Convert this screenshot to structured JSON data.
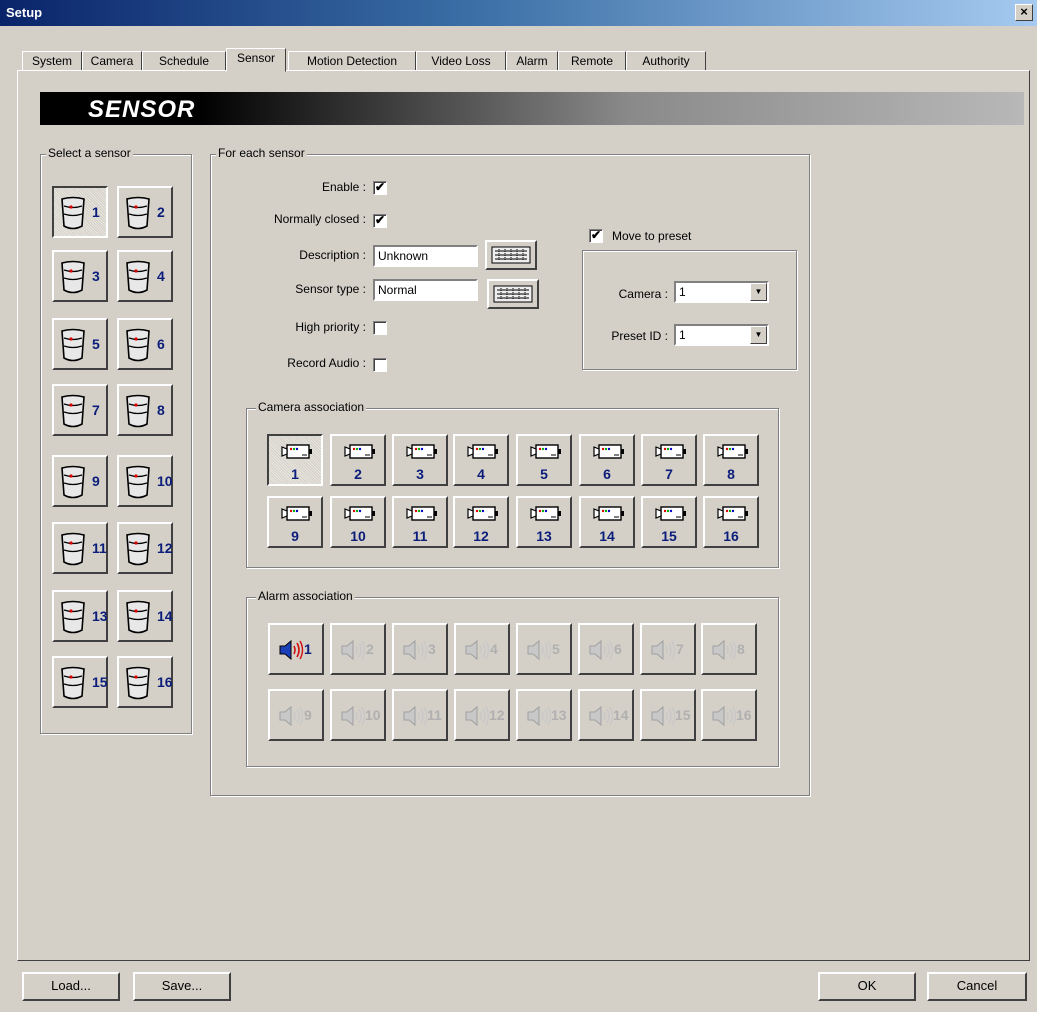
{
  "window": {
    "title": "Setup",
    "close": "×"
  },
  "tabs": [
    "System",
    "Camera",
    "Schedule",
    "Sensor",
    "Motion Detection",
    "Video Loss",
    "Alarm",
    "Remote",
    "Authority"
  ],
  "active_tab": "Sensor",
  "banner": "SENSOR",
  "select_group": {
    "label": "Select a sensor",
    "sensors": [
      "1",
      "2",
      "3",
      "4",
      "5",
      "6",
      "7",
      "8",
      "9",
      "10",
      "11",
      "12",
      "13",
      "14",
      "15",
      "16"
    ],
    "selected": "1"
  },
  "each_group": {
    "label": "For each sensor",
    "enable": {
      "label": "Enable :",
      "checked": true
    },
    "normally_closed": {
      "label": "Normally closed :",
      "checked": true
    },
    "description": {
      "label": "Description :",
      "value": "Unknown"
    },
    "sensor_type": {
      "label": "Sensor type :",
      "value": "Normal"
    },
    "high_priority": {
      "label": "High priority :",
      "checked": false
    },
    "record_audio": {
      "label": "Record Audio :",
      "checked": false
    }
  },
  "preset": {
    "label": "Move to preset",
    "checked": true,
    "camera": {
      "label": "Camera :",
      "value": "1"
    },
    "preset_id": {
      "label": "Preset ID :",
      "value": "1"
    }
  },
  "camera_assoc": {
    "label": "Camera association",
    "cameras": [
      "1",
      "2",
      "3",
      "4",
      "5",
      "6",
      "7",
      "8",
      "9",
      "10",
      "11",
      "12",
      "13",
      "14",
      "15",
      "16"
    ],
    "selected": "1"
  },
  "alarm_assoc": {
    "label": "Alarm association",
    "alarms": [
      "1",
      "2",
      "3",
      "4",
      "5",
      "6",
      "7",
      "8",
      "9",
      "10",
      "11",
      "12",
      "13",
      "14",
      "15",
      "16"
    ],
    "active": "1"
  },
  "footer": {
    "load": "Load...",
    "save": "Save...",
    "ok": "OK",
    "cancel": "Cancel"
  },
  "check_glyph": "✔",
  "colors": {
    "number": "#0b1d7a",
    "disabled": "#b0b0b0",
    "title": "#0a246a"
  }
}
